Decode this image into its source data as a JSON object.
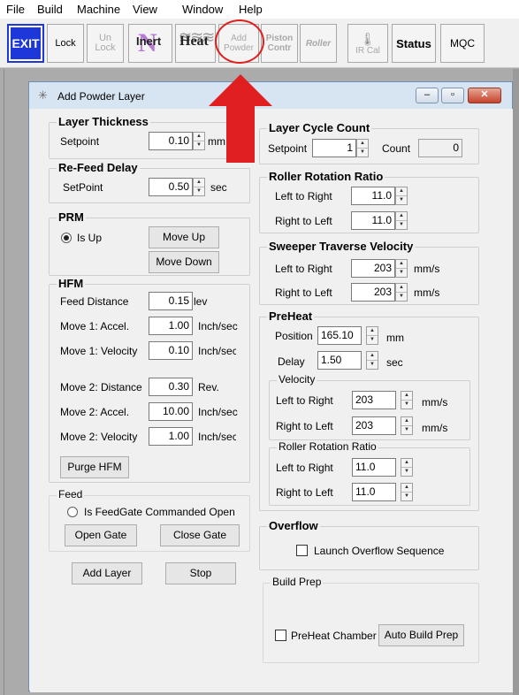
{
  "menu": [
    "File",
    "Build",
    "Machine",
    "View",
    "Window",
    "Help"
  ],
  "toolbar": {
    "exit": "EXIT",
    "lock": "Lock",
    "unlock": "Un\nLock",
    "inert": "Inert",
    "heat": "Heat",
    "add_powder": "Add\nPowder",
    "piston_contr": "Piston\nContr",
    "roller": "Roller",
    "ir_cal": "IR Cal",
    "status": "Status",
    "mqc": "MQC"
  },
  "dialog": {
    "title": "Add Powder Layer",
    "min": "–",
    "max": "▫",
    "close": "✕"
  },
  "layer_thickness": {
    "title": "Layer Thickness",
    "setpoint_label": "Setpoint",
    "setpoint_value": "0.10",
    "unit": "mm"
  },
  "refeed_delay": {
    "title": "Re-Feed Delay",
    "setpoint_label": "SetPoint",
    "setpoint_value": "0.50",
    "unit": "sec"
  },
  "prm": {
    "title": "PRM",
    "is_up": "Is Up",
    "is_up_checked": true,
    "move_up": "Move Up",
    "move_down": "Move Down"
  },
  "hfm": {
    "title": "HFM",
    "feed_distance": {
      "label": "Feed Distance",
      "value": "0.15",
      "unit": "lev"
    },
    "move1_accel": {
      "label": "Move 1: Accel.",
      "value": "1.00",
      "unit": "Inch/sec2"
    },
    "move1_velocity": {
      "label": "Move 1: Velocity",
      "value": "0.10",
      "unit": "Inch/sec"
    },
    "move2_distance": {
      "label": "Move 2: Distance",
      "value": "0.30",
      "unit": "Rev."
    },
    "move2_accel": {
      "label": "Move 2: Accel.",
      "value": "10.00",
      "unit": "Inch/sec2"
    },
    "move2_velocity": {
      "label": "Move 2: Velocity",
      "value": "1.00",
      "unit": "Inch/sec"
    },
    "purge": "Purge HFM"
  },
  "feed": {
    "title": "Feed",
    "gate_commanded": "Is FeedGate Commanded Open",
    "open_gate": "Open Gate",
    "close_gate": "Close Gate"
  },
  "bottom_buttons": {
    "add_layer": "Add Layer",
    "stop": "Stop"
  },
  "layer_cycle": {
    "title": "Layer Cycle Count",
    "setpoint_label": "Setpoint",
    "setpoint_value": "1",
    "count_label": "Count",
    "count_value": "0"
  },
  "roller_ratio": {
    "title": "Roller Rotation Ratio",
    "ltr_label": "Left to Right",
    "ltr_value": "11.0",
    "rtl_label": "Right to Left",
    "rtl_value": "11.0"
  },
  "sweeper": {
    "title": "Sweeper Traverse Velocity",
    "ltr_label": "Left to Right",
    "ltr_value": "203",
    "rtl_label": "Right to Left",
    "rtl_value": "203",
    "unit": "mm/s"
  },
  "preheat": {
    "title": "PreHeat",
    "position_label": "Position",
    "position_value": "165.10",
    "position_unit": "mm",
    "delay_label": "Delay",
    "delay_value": "1.50",
    "delay_unit": "sec",
    "velocity": {
      "title": "Velocity",
      "ltr_label": "Left to Right",
      "ltr_value": "203",
      "rtl_label": "Right to Left",
      "rtl_value": "203",
      "unit": "mm/s"
    },
    "roller": {
      "title": "Roller Rotation Ratio",
      "ltr_label": "Left to Right",
      "ltr_value": "11.0",
      "rtl_label": "Right to Left",
      "rtl_value": "11.0"
    }
  },
  "overflow": {
    "title": "Overflow",
    "launch": "Launch Overflow Sequence"
  },
  "build_prep": {
    "title": "Build Prep",
    "preheat_chamber": "PreHeat Chamber",
    "auto_build_prep": "Auto Build Prep"
  },
  "colors": {
    "exit_blue": "#1d37d8",
    "annotation_red": "#e02020",
    "inert_purple": "#9b3fbf"
  }
}
